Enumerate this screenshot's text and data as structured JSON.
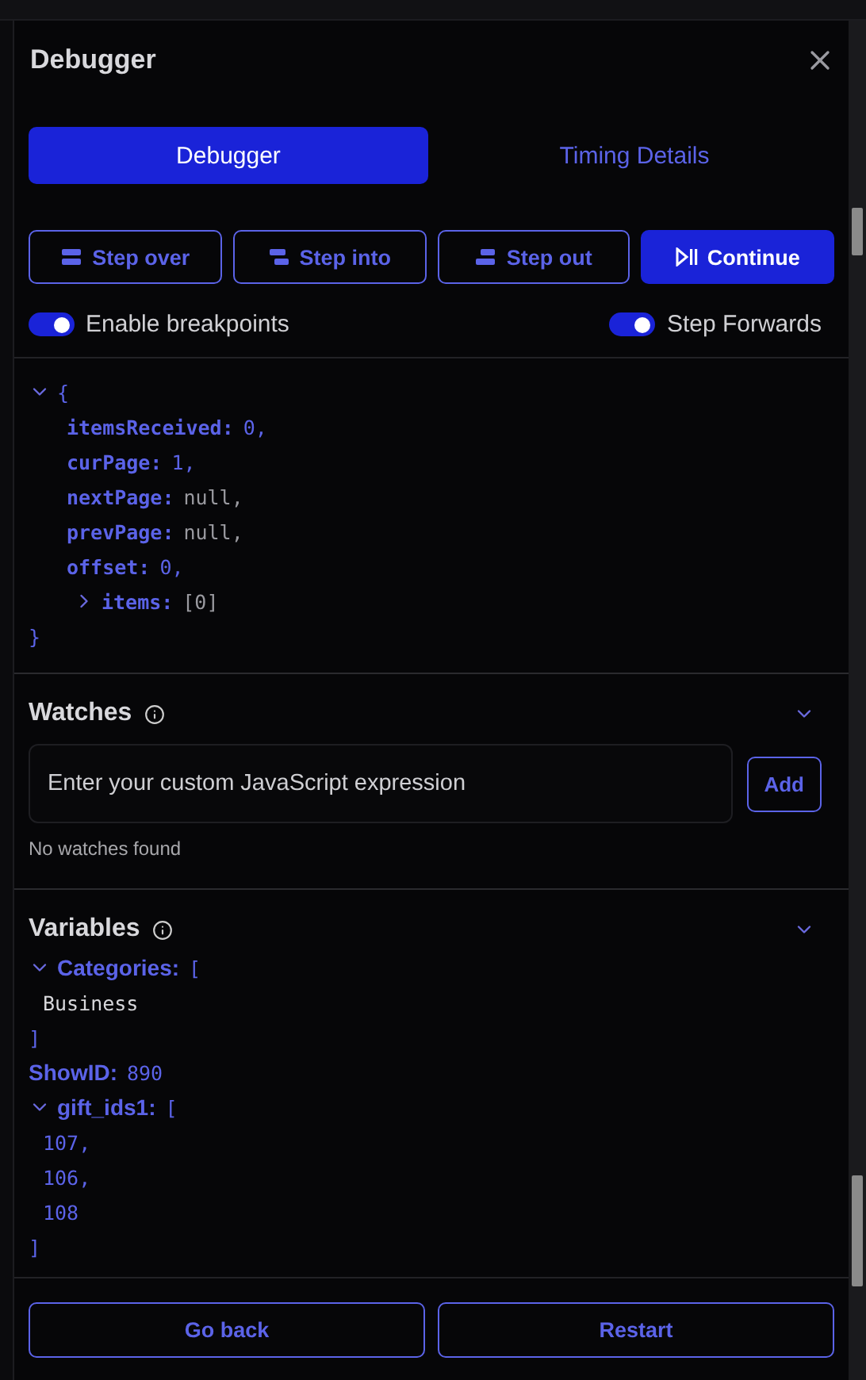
{
  "window": {
    "title": "Debugger"
  },
  "tabs": [
    {
      "label": "Debugger",
      "selected": true
    },
    {
      "label": "Timing Details",
      "selected": false
    }
  ],
  "step_buttons": [
    {
      "label": "Step over",
      "kind": "over",
      "primary": false
    },
    {
      "label": "Step into",
      "kind": "into",
      "primary": false
    },
    {
      "label": "Step out",
      "kind": "out",
      "primary": false
    },
    {
      "label": "Continue",
      "kind": "continue",
      "primary": true
    }
  ],
  "toggles": [
    {
      "label": "Enable breakpoints",
      "on": true
    },
    {
      "label": "Step Forwards",
      "on": true
    }
  ],
  "result": {
    "expanded": true,
    "open": "{",
    "close": "}",
    "entries": [
      {
        "key": "itemsReceived:",
        "value": "0,",
        "kind": "number"
      },
      {
        "key": "curPage:",
        "value": "1,",
        "kind": "number"
      },
      {
        "key": "nextPage:",
        "value": "null,",
        "kind": "null"
      },
      {
        "key": "prevPage:",
        "value": "null,",
        "kind": "null"
      },
      {
        "key": "offset:",
        "value": "0,",
        "kind": "number"
      },
      {
        "key": "items:",
        "value": "[0]",
        "kind": "array",
        "expanded": false
      }
    ]
  },
  "watches": {
    "title": "Watches",
    "expanded": true,
    "placeholder": "Enter your custom JavaScript expression",
    "add_label": "Add",
    "empty": "No watches found"
  },
  "variables": {
    "title": "Variables",
    "expanded": true,
    "items": [
      {
        "key": "Categories:",
        "open": "[",
        "expanded": true,
        "kind": "array",
        "children": [
          {
            "value": "Business",
            "kind": "string"
          }
        ],
        "close": "]"
      },
      {
        "key": "ShowID:",
        "value": "890",
        "kind": "number"
      },
      {
        "key": "gift_ids1:",
        "open": "[",
        "expanded": true,
        "kind": "array",
        "children": [
          {
            "value": "107,",
            "kind": "number"
          },
          {
            "value": "106,",
            "kind": "number"
          },
          {
            "value": "108",
            "kind": "number"
          }
        ],
        "close": "]"
      }
    ]
  },
  "footer": [
    "Go back",
    "Restart"
  ]
}
